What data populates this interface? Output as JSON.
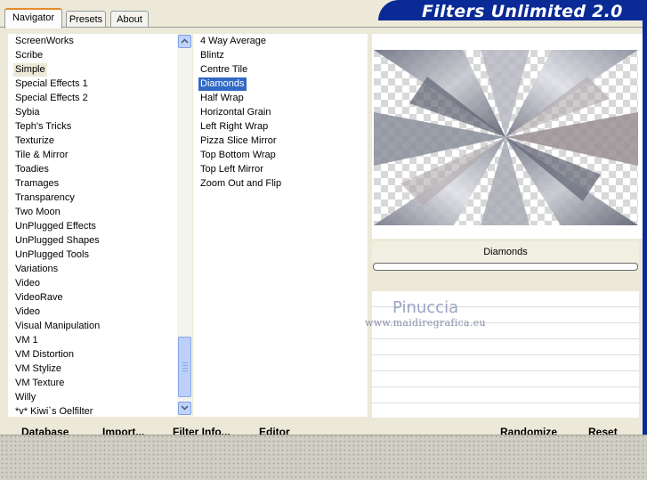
{
  "tabs": {
    "navigator": "Navigator",
    "presets": "Presets",
    "about": "About"
  },
  "banner": {
    "title": "Filters Unlimited 2.0"
  },
  "categories": [
    "ScreenWorks",
    "Scribe",
    "Simple",
    "Special Effects 1",
    "Special Effects 2",
    "Sybia",
    "Teph's Tricks",
    "Texturize",
    "Tile & Mirror",
    "Toadies",
    "Tramages",
    "Transparency",
    "Two Moon",
    "UnPlugged Effects",
    "UnPlugged Shapes",
    "UnPlugged Tools",
    "Variations",
    "Video",
    "VideoRave",
    "Video",
    "Visual Manipulation",
    "VM 1",
    "VM Distortion",
    "VM Stylize",
    "VM Texture",
    "Willy",
    "*v* Kiwi`s Oelfilter"
  ],
  "selected_category": "Simple",
  "filters": [
    "4 Way Average",
    "Blintz",
    "Centre Tile",
    "Diamonds",
    "Half Wrap",
    "Horizontal Grain",
    "Left Right Wrap",
    "Pizza Slice Mirror",
    "Top Bottom Wrap",
    "Top Left Mirror",
    "Zoom Out and Flip"
  ],
  "selected_filter": "Diamonds",
  "preview": {
    "filter_label": "Diamonds",
    "progress": 0
  },
  "watermark": {
    "name": "Pinuccia",
    "url": "www.maidiregrafica.eu"
  },
  "buttons": {
    "database": "Database",
    "import": "Import...",
    "filter_info": "Filter Info...",
    "editor": "Editor",
    "randomize": "Randomize",
    "reset": "Reset"
  },
  "colors": {
    "banner": "#0a2a96",
    "selection": "#316ac5",
    "tab_accent": "#e68b2c"
  },
  "icons": {
    "scroll_up": "chevron-up-icon",
    "scroll_down": "chevron-down-icon"
  }
}
